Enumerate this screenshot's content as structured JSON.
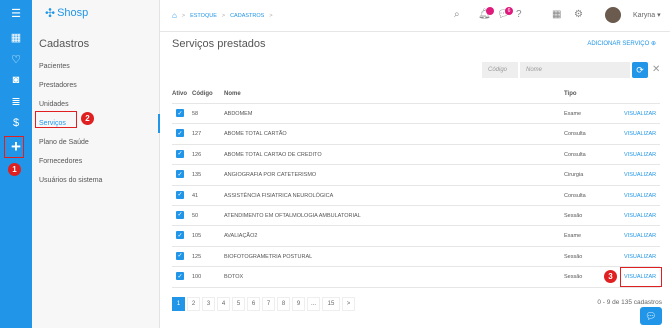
{
  "app": {
    "logo_text": "Shosp"
  },
  "rail": {
    "icons": [
      "menu-icon",
      "calendar-icon",
      "heart-icon",
      "camera-icon",
      "database-icon",
      "dollar-icon",
      "users-icon",
      "add-icon"
    ]
  },
  "panel": {
    "title": "Cadastros",
    "items": [
      {
        "label": "Pacientes"
      },
      {
        "label": "Prestadores"
      },
      {
        "label": "Unidades"
      },
      {
        "label": "Serviços"
      },
      {
        "label": "Plano de Saúde"
      },
      {
        "label": "Fornecedores"
      },
      {
        "label": "Usuários do sistema"
      }
    ]
  },
  "breadcrumb": {
    "items": [
      "ESTOQUE",
      "CADASTROS"
    ],
    "sep": ">"
  },
  "header": {
    "notif_badge_1": "",
    "notif_badge_2": "6",
    "user_name": "Karyna"
  },
  "main": {
    "title": "Serviços prestados",
    "add_label": "ADICIONAR SERVIÇO",
    "filter_code_placeholder": "Código",
    "filter_name_placeholder": "Nome"
  },
  "table": {
    "headers": {
      "ativo": "Ativo",
      "codigo": "Código",
      "nome": "Nome",
      "tipo": "Tipo"
    },
    "rows": [
      {
        "codigo": "58",
        "nome": "ABDOMEM",
        "tipo": "Exame",
        "acao": "VISUALIZAR"
      },
      {
        "codigo": "127",
        "nome": "ABOME TOTAL CARTÃO",
        "tipo": "Consulta",
        "acao": "VISUALIZAR"
      },
      {
        "codigo": "126",
        "nome": "ABOME TOTAL CARTAO DE CREDITO",
        "tipo": "Consulta",
        "acao": "VISUALIZAR"
      },
      {
        "codigo": "135",
        "nome": "ANGIOGRAFIA POR CATETERISMO",
        "tipo": "Cirurgia",
        "acao": "VISUALIZAR"
      },
      {
        "codigo": "41",
        "nome": "ASSISTÊNCIA FISIATRICA NEUROLÓGICA",
        "tipo": "Consulta",
        "acao": "VISUALIZAR"
      },
      {
        "codigo": "50",
        "nome": "ATENDIMENTO EM OFTALMOLOGIA AMBULATORIAL",
        "tipo": "Sessão",
        "acao": "VISUALIZAR"
      },
      {
        "codigo": "105",
        "nome": "AVALIAÇÃO2",
        "tipo": "Exame",
        "acao": "VISUALIZAR"
      },
      {
        "codigo": "125",
        "nome": "BIOFOTOGRAMETRIA POSTURAL",
        "tipo": "Sessão",
        "acao": "VISUALIZAR"
      },
      {
        "codigo": "100",
        "nome": "BOTOX",
        "tipo": "Sessão",
        "acao": "VISUALIZAR"
      }
    ]
  },
  "pagination": {
    "pages": [
      "1",
      "2",
      "3",
      "4",
      "5",
      "6",
      "7",
      "8",
      "9",
      "...",
      "15",
      ">"
    ],
    "summary": "0 - 9 de 135 cadastros"
  },
  "annotations": {
    "one": "1",
    "two": "2",
    "three": "3"
  },
  "colors": {
    "accent": "#2196e8",
    "highlight": "#e02020"
  }
}
